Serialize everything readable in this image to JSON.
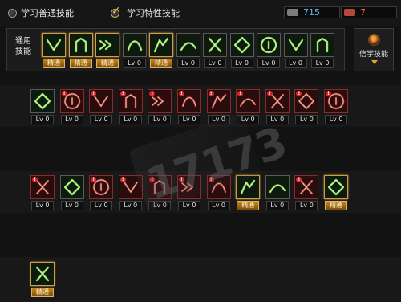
{
  "tabs": [
    {
      "label": "学习普通技能",
      "selected": false
    },
    {
      "label": "学习特性技能",
      "selected": true
    }
  ],
  "currency": {
    "points": {
      "icon": "coin-icon",
      "value": "715",
      "color": "#5ab7e8"
    },
    "special": {
      "icon": "ticket-icon",
      "value": "7",
      "color": "#e8603a"
    }
  },
  "common_panel": {
    "title": "通用技能"
  },
  "side_button": {
    "label": "信学技能",
    "icon": "orb-icon"
  },
  "mastered_label": "精通",
  "watermark": "17173",
  "common_skills": [
    {
      "icon": "dash-icon",
      "level": "精通"
    },
    {
      "icon": "leap-icon",
      "level": "精通"
    },
    {
      "icon": "backstep-icon",
      "level": "精通"
    },
    {
      "icon": "wings-icon",
      "level": "Lv 0"
    },
    {
      "icon": "target-icon",
      "level": "精通"
    },
    {
      "icon": "crosshair-icon",
      "level": "Lv 0"
    },
    {
      "icon": "sprint-icon",
      "level": "Lv 0"
    },
    {
      "icon": "kick-icon",
      "level": "Lv 0"
    },
    {
      "icon": "vortex-icon",
      "level": "Lv 0"
    },
    {
      "icon": "guard-icon",
      "level": "Lv 0"
    },
    {
      "icon": "throw-icon",
      "level": "Lv 0"
    }
  ],
  "row1_skills": [
    {
      "icon": "runner-icon",
      "level": "Lv 0",
      "locked": false
    },
    {
      "icon": "slash-icon",
      "level": "Lv 0",
      "locked": true
    },
    {
      "icon": "claw-icon",
      "level": "Lv 0",
      "locked": true
    },
    {
      "icon": "arrows-icon",
      "level": "Lv 0",
      "locked": true
    },
    {
      "icon": "wave-icon",
      "level": "Lv 0",
      "locked": true
    },
    {
      "icon": "shield-icon",
      "level": "Lv 0",
      "locked": true
    },
    {
      "icon": "spin-icon",
      "level": "Lv 0",
      "locked": true
    },
    {
      "icon": "crescent-icon",
      "level": "Lv 0",
      "locked": true
    },
    {
      "icon": "blast-icon",
      "level": "Lv 0",
      "locked": true
    },
    {
      "icon": "impact-icon",
      "level": "Lv 0",
      "locked": true
    },
    {
      "icon": "strike-icon",
      "level": "Lv 0",
      "locked": true
    }
  ],
  "row2_skills": [
    {
      "icon": "swirl-icon",
      "level": "Lv 0",
      "locked": true
    },
    {
      "icon": "fighter-icon",
      "level": "Lv 0",
      "locked": false
    },
    {
      "icon": "armor-icon",
      "level": "Lv 0",
      "locked": true
    },
    {
      "icon": "hook-icon",
      "level": "Lv 0",
      "locked": true
    },
    {
      "icon": "arc-icon",
      "level": "Lv 0",
      "locked": true
    },
    {
      "icon": "burst-icon",
      "level": "Lv 0",
      "locked": true
    },
    {
      "icon": "flame-icon",
      "level": "Lv 0",
      "locked": true
    },
    {
      "icon": "sword-icon",
      "level": "精通",
      "locked": false
    },
    {
      "icon": "dragon-icon",
      "level": "Lv 0",
      "locked": false
    },
    {
      "icon": "moon-icon",
      "level": "Lv 0",
      "locked": true
    },
    {
      "icon": "star-icon",
      "level": "精通",
      "locked": false
    }
  ],
  "row3_skills": [
    {
      "icon": "awaken-icon",
      "level": "精通",
      "locked": false
    }
  ],
  "colors": {
    "gold": "#d7a23c",
    "glow": "#7ee04a",
    "locked": "#d2282a"
  }
}
